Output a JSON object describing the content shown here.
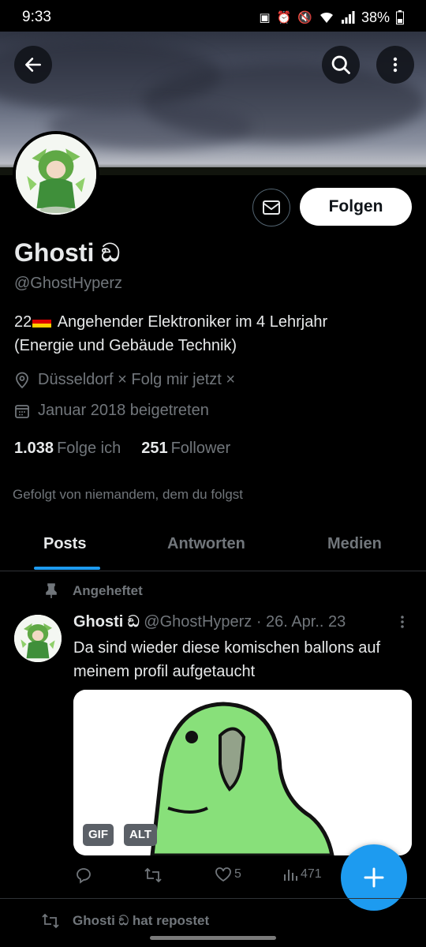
{
  "status_bar": {
    "time": "9:33",
    "battery": "38%"
  },
  "profile": {
    "name": "Ghosti ඞ",
    "handle": "@GhostHyperz",
    "bio_prefix": "22",
    "bio_line1": " Angehender Elektroniker im 4 Lehrjahr",
    "bio_line2": "(Energie und Gebäude Technik)",
    "location": "Düsseldorf  × Folg mir jetzt ×",
    "joined": "Januar 2018 beigetreten",
    "following_count": "1.038",
    "following_label": "Folge ich",
    "followers_count": "251",
    "followers_label": "Follower",
    "followed_by": "Gefolgt von niemandem, dem du folgst",
    "follow_button": "Folgen"
  },
  "tabs": [
    {
      "label": "Posts",
      "active": true
    },
    {
      "label": "Antworten",
      "active": false
    },
    {
      "label": "Medien",
      "active": false
    }
  ],
  "pinned_post": {
    "pinned_label": "Angeheftet",
    "author_name": "Ghosti ඞ",
    "author_meta": " @GhostHyperz · 26. Apr.. 23",
    "text": "Da sind wieder diese komischen ballons auf meinem profil aufgetaucht",
    "media_badges": {
      "gif": "GIF",
      "alt": "ALT"
    },
    "likes": "5",
    "views": "471"
  },
  "next_item": {
    "repost_label": "Ghosti ඞ hat repostet"
  },
  "icons": {
    "back": "arrow-left-icon",
    "search": "search-icon",
    "more": "more-vertical-icon",
    "message": "envelope-icon",
    "location": "location-pin-icon",
    "calendar": "calendar-icon",
    "pin": "pin-icon",
    "reply": "reply-icon",
    "repost": "repost-icon",
    "like": "heart-icon",
    "views": "analytics-icon",
    "compose": "plus-icon"
  },
  "colors": {
    "accent": "#1d9bf0",
    "background": "#000000",
    "secondary_text": "#71767b",
    "parrot": "#88e07a"
  }
}
